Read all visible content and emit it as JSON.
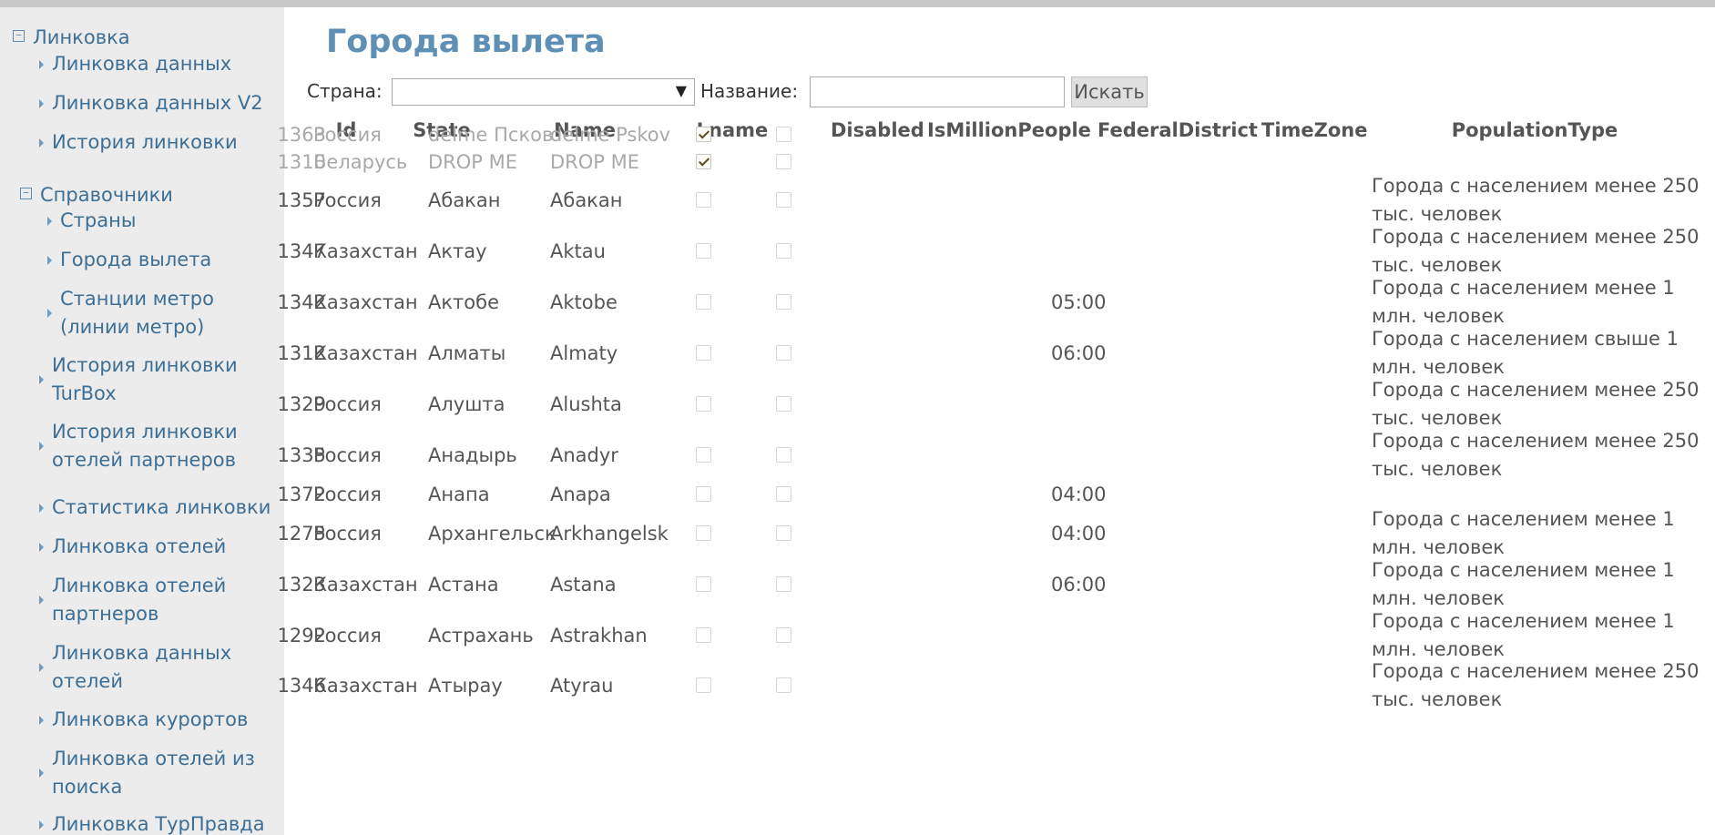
{
  "sidebar": {
    "root1": "Линковка",
    "root1_items": [
      "Линковка данных",
      "Линковка данных V2",
      "История линковки"
    ],
    "root2": "Справочники",
    "root2_items": [
      "Страны",
      "Города вылета"
    ],
    "wrapped_items": [
      [
        "Станции метро",
        "(линии метро)"
      ],
      [
        "История линковки",
        "TurBox"
      ],
      [
        "История линковки",
        "отелей партнеров"
      ]
    ],
    "items_after": [
      "Статистика линковки",
      "Линковка отелей"
    ],
    "wrapped_items2": [
      [
        "Линковка отелей",
        "партнеров"
      ],
      [
        "Линковка данных",
        "отелей"
      ]
    ],
    "item_resorts": "Линковка курортов",
    "wrapped_items3": [
      [
        "Линковка отелей из",
        "поиска"
      ]
    ],
    "last_item": "Линковка ТурПравда"
  },
  "page": {
    "title": "Города вылета"
  },
  "filters": {
    "country_label": "Страна:",
    "country_value": "",
    "name_label": "Название:",
    "name_value": "",
    "search_label": "Искать"
  },
  "table": {
    "headers": [
      "Id",
      "State",
      "Name",
      "Lname",
      "Disabled",
      "IsMillionPeople",
      "FederalDistrict",
      "TimeZone",
      "PopulationType"
    ],
    "rows": [
      {
        "id": "1363",
        "state": "Россия",
        "name": "delme Псков",
        "lname": "delme Pskov",
        "disabled": true,
        "million": false,
        "district": "",
        "tz": "",
        "pop": ""
      },
      {
        "id": "1310",
        "state": "Беларусь",
        "name": "DROP ME",
        "lname": "DROP ME",
        "disabled": true,
        "million": false,
        "district": "",
        "tz": "",
        "pop": ""
      },
      {
        "id": "1357",
        "state": "Россия",
        "name": "Абакан",
        "lname": "Абакан",
        "disabled": false,
        "million": false,
        "district": "",
        "tz": "",
        "pop": "Города с населением менее 250 тыс. человек"
      },
      {
        "id": "1347",
        "state": "Казахстан",
        "name": "Актау",
        "lname": "Aktau",
        "disabled": false,
        "million": false,
        "district": "",
        "tz": "",
        "pop": "Города с населением менее 250 тыс. человек"
      },
      {
        "id": "1342",
        "state": "Казахстан",
        "name": "Актобе",
        "lname": "Aktobe",
        "disabled": false,
        "million": false,
        "district": "",
        "tz": "05:00",
        "pop": "Города с населением менее 1 млн. человек"
      },
      {
        "id": "1312",
        "state": "Казахстан",
        "name": "Алматы",
        "lname": "Almaty",
        "disabled": false,
        "million": false,
        "district": "",
        "tz": "06:00",
        "pop": "Города с населением свыше 1 млн. человек"
      },
      {
        "id": "1329",
        "state": "Россия",
        "name": "Алушта",
        "lname": "Alushta",
        "disabled": false,
        "million": false,
        "district": "",
        "tz": "",
        "pop": "Города с населением менее 250 тыс. человек"
      },
      {
        "id": "1335",
        "state": "Россия",
        "name": "Анадырь",
        "lname": "Anadyr",
        "disabled": false,
        "million": false,
        "district": "",
        "tz": "",
        "pop": "Города с населением менее 250 тыс. человек"
      },
      {
        "id": "1372",
        "state": "Россия",
        "name": "Анапа",
        "lname": "Anapa",
        "disabled": false,
        "million": false,
        "district": "",
        "tz": "04:00",
        "pop": ""
      },
      {
        "id": "1275",
        "state": "Россия",
        "name": "Архангельск",
        "lname": "Arkhangelsk",
        "disabled": false,
        "million": false,
        "district": "",
        "tz": "04:00",
        "pop": "Города с населением менее 1 млн. человек"
      },
      {
        "id": "1323",
        "state": "Казахстан",
        "name": "Астана",
        "lname": "Astana",
        "disabled": false,
        "million": false,
        "district": "",
        "tz": "06:00",
        "pop": "Города с населением менее 1 млн. человек"
      },
      {
        "id": "1292",
        "state": "Россия",
        "name": "Астрахань",
        "lname": "Astrakhan",
        "disabled": false,
        "million": false,
        "district": "",
        "tz": "",
        "pop": "Города с населением менее 1 млн. человек"
      },
      {
        "id": "1346",
        "state": "Казахстан",
        "name": "Атырау",
        "lname": "Atyrau",
        "disabled": false,
        "million": false,
        "district": "",
        "tz": "",
        "pop": "Города с населением менее 250 тыс. человек"
      }
    ]
  }
}
